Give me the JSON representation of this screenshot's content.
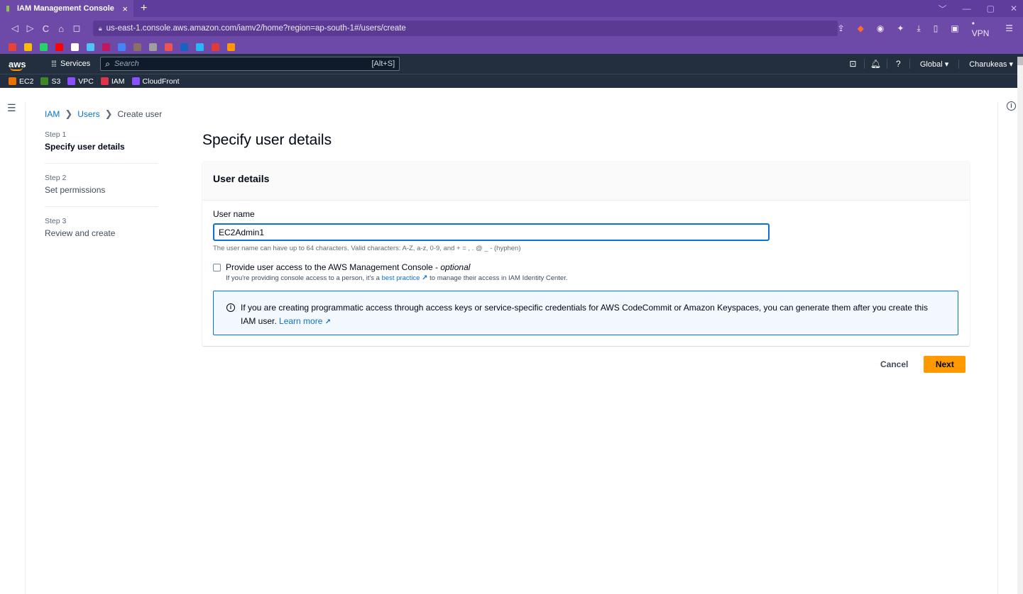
{
  "browser": {
    "tab_title": "IAM Management Console",
    "tab_close": "×",
    "new_tab": "+",
    "url": "us-east-1.console.aws.amazon.com/iamv2/home?region=ap-south-1#/users/create",
    "vpn_label": "• VPN",
    "bookmark_colors": [
      "#ea4335",
      "#fbbc04",
      "#25d366",
      "#ff0000",
      "#ffffff",
      "#4fc3f7",
      "#c2185b",
      "#4285f4",
      "#8d6e63",
      "#9e9e9e",
      "#ef5350",
      "#1565c0",
      "#29b6f6",
      "#e53935",
      "#ff9800"
    ]
  },
  "aws_nav": {
    "logo": "aws",
    "services_label": "Services",
    "search_placeholder": "Search",
    "search_shortcut": "[Alt+S]",
    "region": "Global ▾",
    "account": "Charukeas ▾"
  },
  "favorites": [
    {
      "label": "EC2",
      "color": "#ed7100"
    },
    {
      "label": "S3",
      "color": "#3f8624"
    },
    {
      "label": "VPC",
      "color": "#8c4fff"
    },
    {
      "label": "IAM",
      "color": "#dd344c"
    },
    {
      "label": "CloudFront",
      "color": "#8c4fff"
    }
  ],
  "breadcrumb": {
    "iam": "IAM",
    "users": "Users",
    "current": "Create user",
    "separator": "❯"
  },
  "steps": [
    {
      "num": "Step 1",
      "label": "Specify user details"
    },
    {
      "num": "Step 2",
      "label": "Set permissions"
    },
    {
      "num": "Step 3",
      "label": "Review and create"
    }
  ],
  "page_title": "Specify user details",
  "card": {
    "title": "User details",
    "username_label": "User name",
    "username_value": "EC2Admin1",
    "username_hint": "The user name can have up to 64 characters. Valid characters: A-Z, a-z, 0-9, and + = , . @ _ - (hyphen)",
    "console_access_title": "Provide user access to the AWS Management Console - ",
    "console_access_optional": "optional",
    "console_access_desc_pre": "If you're providing console access to a person, it's a ",
    "console_access_link": "best practice",
    "console_access_desc_post": " to manage their access in IAM Identity Center.",
    "alert_text": "If you are creating programmatic access through access keys or service-specific credentials for AWS CodeCommit or Amazon Keyspaces, you can generate them after you create this IAM user. ",
    "alert_link": "Learn more"
  },
  "actions": {
    "cancel": "Cancel",
    "next": "Next"
  }
}
